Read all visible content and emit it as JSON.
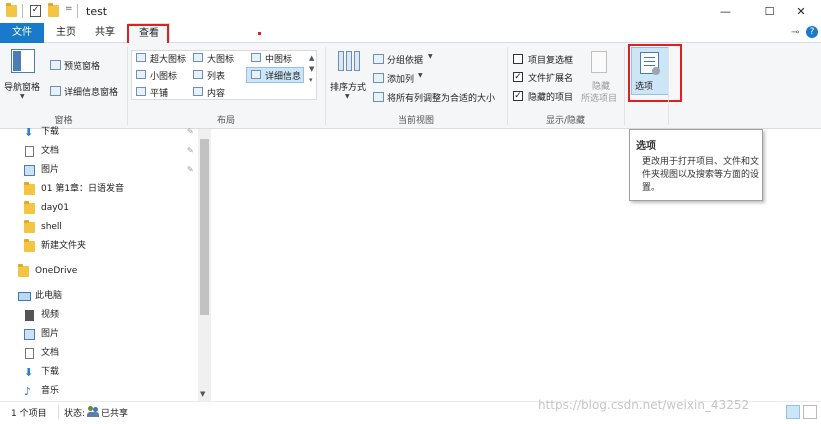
{
  "window": {
    "title": "test",
    "minimize_glyph": "—",
    "maximize_glyph": "☐",
    "close_glyph": "✕",
    "qa_dropdown_glyph": "="
  },
  "tabs": [
    {
      "label": "文件"
    },
    {
      "label": "主页"
    },
    {
      "label": "共享"
    },
    {
      "label": "查看"
    }
  ],
  "ribbon": {
    "pane": {
      "nav_pane": "导航窗格",
      "preview_pane": "预览窗格",
      "details_pane": "详细信息窗格",
      "group_label": "窗格"
    },
    "layout": {
      "items": {
        "extra_large": "超大图标",
        "large": "大图标",
        "medium": "中图标",
        "small": "小图标",
        "list": "列表",
        "details": "详细信息",
        "tiles": "平铺",
        "content": "内容"
      },
      "group_label": "布局"
    },
    "current_view": {
      "sort_by": "排序方式",
      "group_by": "分组依据",
      "add_columns": "添加列",
      "size_all": "将所有列调整为合适的大小",
      "group_label": "当前视图"
    },
    "show_hide": {
      "item_checkboxes": "项目复选框",
      "file_extensions": "文件扩展名",
      "hidden_items": "隐藏的项目",
      "hide_selected_1": "隐藏",
      "hide_selected_2": "所选项目",
      "group_label": "显示/隐藏"
    },
    "options": {
      "label": "选项"
    }
  },
  "tooltip": {
    "title": "选项",
    "body": "更改用于打开项目、文件和文件夹视图以及搜索等方面的设置。"
  },
  "nav": {
    "quick_access": [
      {
        "label": "下载"
      },
      {
        "label": "文档"
      },
      {
        "label": "图片"
      },
      {
        "label": "01 第1章：日语发音"
      },
      {
        "label": "day01"
      },
      {
        "label": "shell"
      },
      {
        "label": "新建文件夹"
      }
    ],
    "onedrive": "OneDrive",
    "this_pc": "此电脑",
    "pc_items": [
      {
        "label": "视频"
      },
      {
        "label": "图片"
      },
      {
        "label": "文档"
      },
      {
        "label": "下载"
      },
      {
        "label": "音乐"
      }
    ]
  },
  "status": {
    "item_count": "1 个项目",
    "state_label": "状态:",
    "state_value": "已共享"
  },
  "watermark": "https://blog.csdn.net/weixin_43252",
  "colors": {
    "file_tab": "#1979ca",
    "highlight": "#e02020",
    "folder": "#f4c542",
    "selected": "#cde6f7"
  }
}
